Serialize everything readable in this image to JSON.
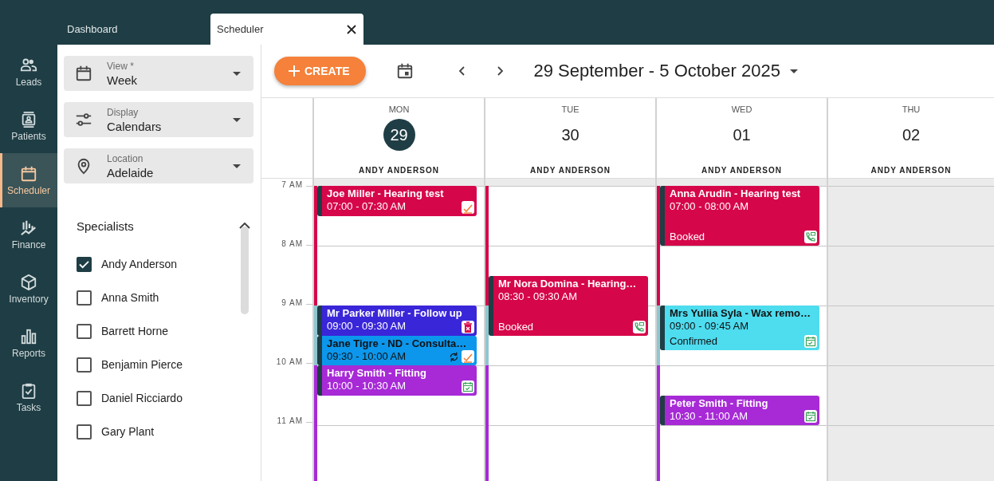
{
  "tabs": [
    {
      "label": "Dashboard",
      "selected": false,
      "closable": false
    },
    {
      "label": "Scheduler",
      "selected": true,
      "closable": true
    }
  ],
  "nav": [
    {
      "label": "Leads",
      "selected": false
    },
    {
      "label": "Patients",
      "selected": false
    },
    {
      "label": "Scheduler",
      "selected": true
    },
    {
      "label": "Finance",
      "selected": false
    },
    {
      "label": "Inventory",
      "selected": false
    },
    {
      "label": "Reports",
      "selected": false
    },
    {
      "label": "Tasks",
      "selected": false
    }
  ],
  "filters": [
    {
      "label": "View *",
      "value": "Week"
    },
    {
      "label": "Display",
      "value": "Calendars"
    },
    {
      "label": "Location",
      "value": "Adelaide"
    }
  ],
  "specialists": {
    "title": "Specialists",
    "expanded": true,
    "items": [
      {
        "name": "Andy Anderson",
        "checked": true
      },
      {
        "name": "Anna Smith",
        "checked": false
      },
      {
        "name": "Barrett Horne",
        "checked": false
      },
      {
        "name": "Benjamin Pierce",
        "checked": false
      },
      {
        "name": "Daniel Ricciardo",
        "checked": false
      },
      {
        "name": "Gary Plant",
        "checked": false
      }
    ]
  },
  "toolbar": {
    "create": "CREATE",
    "range": "29 September - 5 October 2025"
  },
  "times": [
    "7 AM",
    "8 AM",
    "9 AM",
    "10 AM",
    "11 AM"
  ],
  "days": [
    {
      "weekday": "MON",
      "date": "29",
      "today": true,
      "specialist": "ANDY ANDERSON",
      "disabled": false,
      "slots": [
        {
          "color": "#d6064a"
        },
        {
          "color": "#d6064a"
        },
        {
          "color": "#8fc6cf"
        },
        {
          "color": "#a72ad6"
        },
        {
          "color": "#a72ad6"
        }
      ],
      "events": [
        {
          "title": "Joe Miller - Hearing test",
          "time": "07:00 - 07:30 AM",
          "color": "#d6064a",
          "kind": "check",
          "repeat": false
        },
        {
          "title": "Mr Parker Miller - Follow up",
          "time": "09:00 - 09:30 AM",
          "color": "#3a26d9",
          "kind": "trash",
          "repeat": false
        },
        {
          "title": "Jane Tigre - ND - Consulta…",
          "time": "09:30 - 10:00 AM",
          "color": "#0c97ec",
          "kind": "check",
          "repeat": true
        },
        {
          "title": "Harry Smith - Fitting",
          "time": "10:00 - 10:30 AM",
          "color": "#a72ad6",
          "kind": "calendar",
          "repeat": false
        }
      ]
    },
    {
      "weekday": "TUE",
      "date": "30",
      "today": false,
      "specialist": "ANDY ANDERSON",
      "disabled": false,
      "slots": [
        {
          "color": "#d6064a"
        },
        {
          "color": "#d6064a"
        },
        {
          "color": "#8fc6cf"
        },
        {
          "color": "#a72ad6"
        },
        {
          "color": "#a72ad6"
        }
      ],
      "events": [
        {
          "title": "Mr Nora Domina - Hearing…",
          "time": "08:30 - 09:30 AM",
          "status": "Booked",
          "color": "#d6064a",
          "kind": "phone",
          "repeat": false
        }
      ]
    },
    {
      "weekday": "WED",
      "date": "01",
      "today": false,
      "specialist": "ANDY ANDERSON",
      "disabled": false,
      "slots": [
        {
          "color": "#d6064a"
        },
        {
          "color": "#d6064a"
        },
        {
          "color": "#8fc6cf"
        },
        {
          "color": "#a72ad6"
        },
        {
          "color": "#a72ad6"
        }
      ],
      "events": [
        {
          "title": "Anna Arudin - Hearing test",
          "time": "07:00 - 08:00 AM",
          "status": "Booked",
          "color": "#d6064a",
          "kind": "phone",
          "repeat": false
        },
        {
          "title": "Mrs Yuliia Syla - Wax remo…",
          "time": "09:00 - 09:45 AM",
          "status": "Confirmed",
          "color": "#4edcef",
          "kind": "calendar",
          "repeat": false
        },
        {
          "title": "Peter Smith - Fitting",
          "time": "10:30 - 11:00 AM",
          "color": "#a72ad6",
          "kind": "calendar",
          "repeat": false
        }
      ]
    },
    {
      "weekday": "THU",
      "date": "02",
      "today": false,
      "specialist": "ANDY ANDERSON",
      "disabled": true
    }
  ]
}
